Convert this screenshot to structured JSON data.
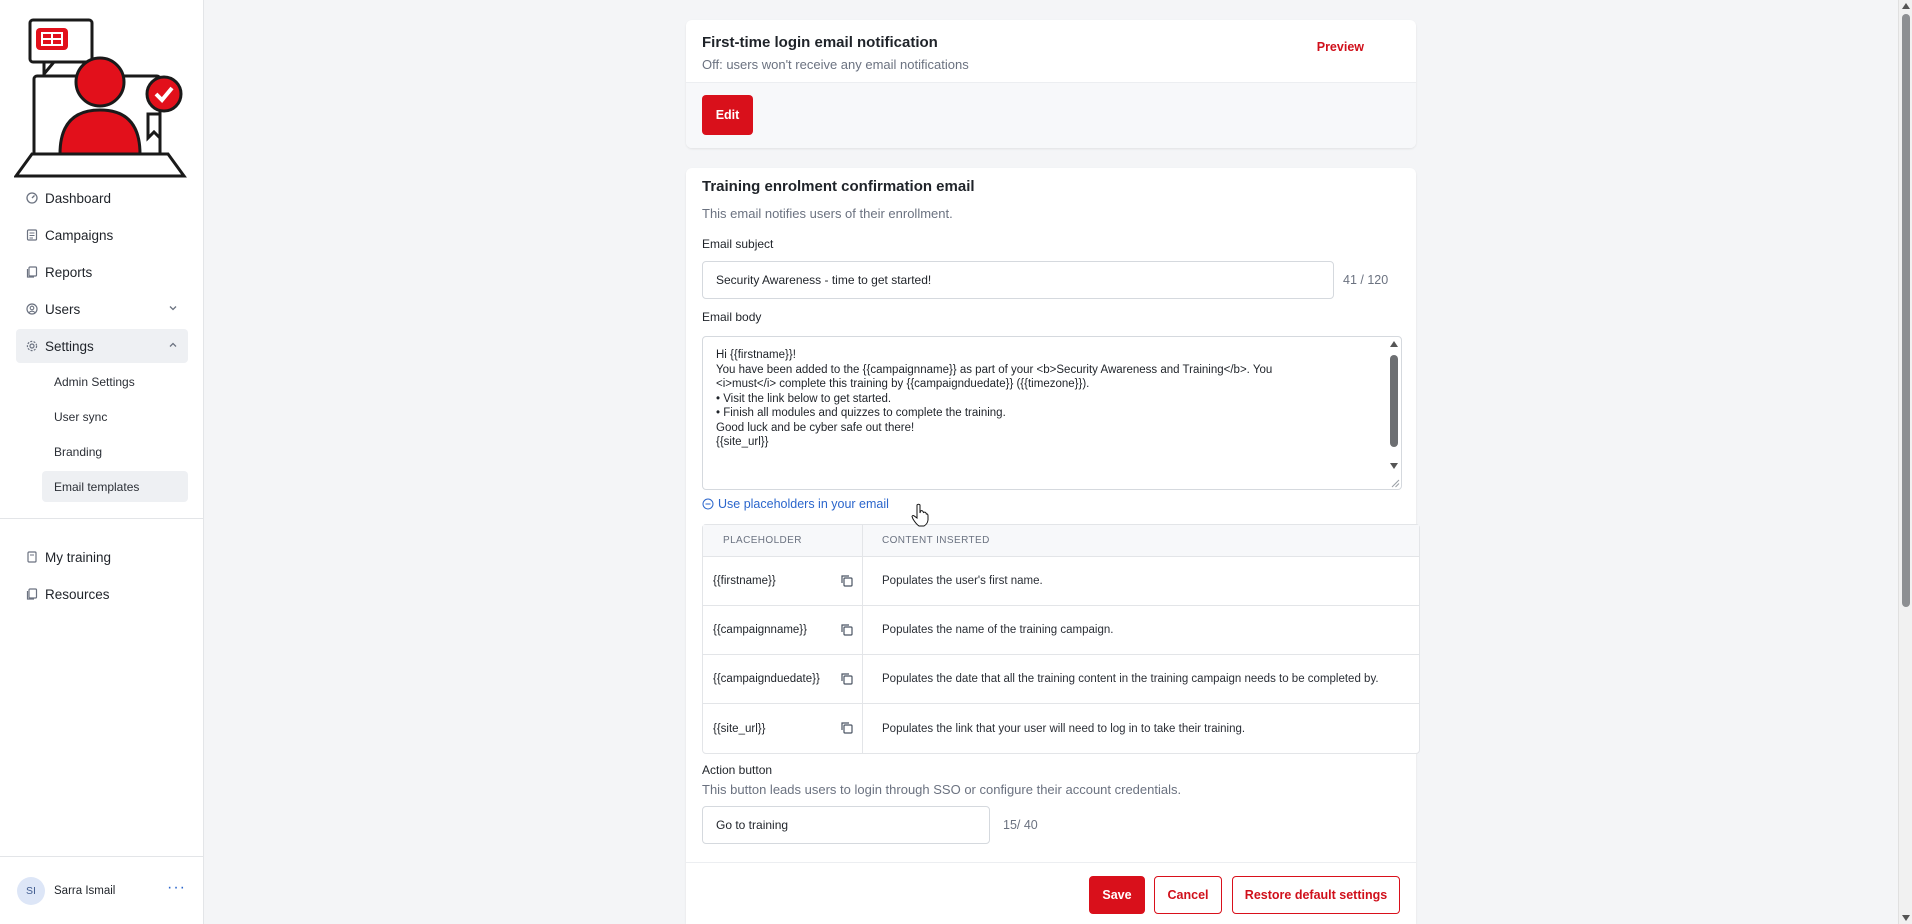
{
  "sidebar": {
    "items": [
      {
        "label": "Dashboard",
        "icon": "gauge-icon"
      },
      {
        "label": "Campaigns",
        "icon": "list-icon"
      },
      {
        "label": "Reports",
        "icon": "report-icon"
      },
      {
        "label": "Users",
        "icon": "user-circle-icon"
      },
      {
        "label": "Settings",
        "icon": "gear-icon"
      }
    ],
    "settings_sub": [
      "Admin Settings",
      "User sync",
      "Branding",
      "Email templates"
    ],
    "secondary": [
      {
        "label": "My training",
        "icon": "book-icon"
      },
      {
        "label": "Resources",
        "icon": "resources-icon"
      }
    ],
    "user": {
      "initials": "SI",
      "name": "Sarra Ismail",
      "more": "···"
    }
  },
  "card1": {
    "title": "First-time login email notification",
    "subtitle": "Off: users won't receive any email notifications",
    "preview": "Preview",
    "edit": "Edit"
  },
  "card2": {
    "title": "Training enrolment confirmation email",
    "subtitle": "This email notifies users of their enrollment.",
    "subject_label": "Email subject",
    "subject_value": "Security Awareness - time to get started!",
    "subject_counter": "41 / 120",
    "body_label": "Email body",
    "body_lines": [
      "Hi {{firstname}}!",
      "",
      "You have been added to the {{campaignname}} as part of your <b>Security Awareness and Training</b>. You",
      "<i>must</i> complete this training by {{campaignduedate}} ({{timezone}}).",
      "",
      "• Visit the link below to get started.",
      "• Finish all modules and quizzes to complete the training.",
      "",
      "Good luck and be cyber safe out there!",
      "{{site_url}}"
    ],
    "placeholder_toggle": "Use placeholders in your email",
    "table": {
      "headers": [
        "PLACEHOLDER",
        "CONTENT INSERTED"
      ],
      "rows": [
        {
          "placeholder": "{{firstname}}",
          "content": "Populates the user's first name."
        },
        {
          "placeholder": "{{campaignname}}",
          "content": "Populates the name of the training campaign."
        },
        {
          "placeholder": "{{campaignduedate}}",
          "content": "Populates the date that all the training content in the training campaign needs to be completed by."
        },
        {
          "placeholder": "{{site_url}}",
          "content": "Populates the link that your user will need to log in to take their training."
        }
      ]
    },
    "action_label": "Action button",
    "action_sub": "This button leads users to login through SSO or configure their account credentials.",
    "action_value": "Go to training",
    "action_counter": "15/ 40",
    "save": "Save",
    "cancel": "Cancel",
    "restore": "Restore default settings"
  },
  "colors": {
    "brand_red": "#d9101b",
    "link_blue": "#2b66cc"
  }
}
